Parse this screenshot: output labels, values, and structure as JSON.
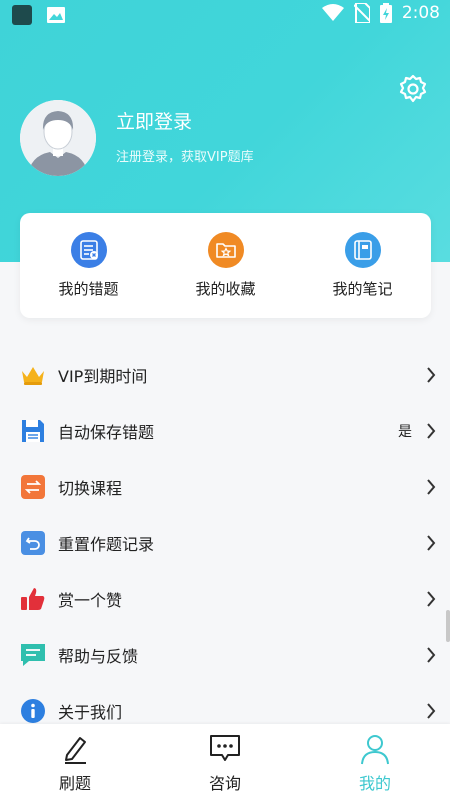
{
  "status_bar": {
    "time": "2:08"
  },
  "profile": {
    "login_title": "立即登录",
    "login_subtitle": "注册登录，获取VIP题库"
  },
  "quick_actions": [
    {
      "label": "我的错题",
      "icon": "wrong-questions-icon",
      "color": "#3b7fe6"
    },
    {
      "label": "我的收藏",
      "icon": "favorites-folder-icon",
      "color": "#f08a24"
    },
    {
      "label": "我的笔记",
      "icon": "notebook-icon",
      "color": "#3a9ee8"
    }
  ],
  "menu": [
    {
      "label": "VIP到期时间",
      "icon": "crown-icon",
      "value": ""
    },
    {
      "label": "自动保存错题",
      "icon": "save-icon",
      "value": "是"
    },
    {
      "label": "切换课程",
      "icon": "switch-icon",
      "value": ""
    },
    {
      "label": "重置作题记录",
      "icon": "reset-icon",
      "value": ""
    },
    {
      "label": "赏一个赞",
      "icon": "thumbs-up-icon",
      "value": ""
    },
    {
      "label": "帮助与反馈",
      "icon": "feedback-icon",
      "value": ""
    },
    {
      "label": "关于我们",
      "icon": "info-icon",
      "value": ""
    }
  ],
  "tabs": [
    {
      "label": "刷题",
      "icon": "pencil-icon",
      "active": false
    },
    {
      "label": "咨询",
      "icon": "chat-icon",
      "active": false
    },
    {
      "label": "我的",
      "icon": "user-icon",
      "active": true
    }
  ],
  "colors": {
    "accent": "#3ec8cf",
    "header_gradient_start": "#3fd3d8"
  }
}
